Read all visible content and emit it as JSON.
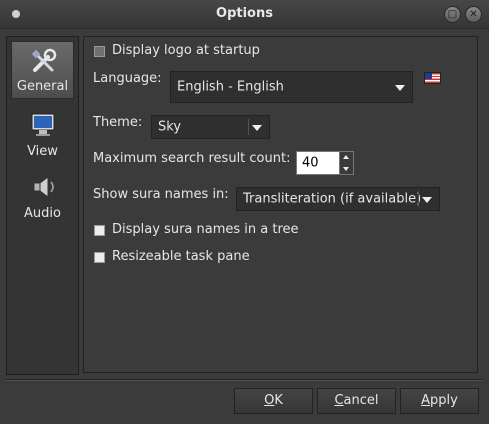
{
  "window": {
    "title": "Options"
  },
  "sidebar": {
    "items": [
      {
        "label": "General",
        "icon": "tools-icon",
        "active": true
      },
      {
        "label": "View",
        "icon": "monitor-icon",
        "active": false
      },
      {
        "label": "Audio",
        "icon": "speaker-icon",
        "active": false
      }
    ]
  },
  "general": {
    "display_logo": {
      "label": "Display logo at startup",
      "checked": false
    },
    "language": {
      "label": "Language:",
      "value": "English - English",
      "flag_icon": "us-flag-icon"
    },
    "theme": {
      "label": "Theme:",
      "value": "Sky"
    },
    "max_search": {
      "label": "Maximum search result count:",
      "value": "40"
    },
    "sura_names": {
      "label": "Show sura names in:",
      "value": "Transliteration (if available)"
    },
    "sura_tree": {
      "label": "Display sura names in a tree",
      "checked": false
    },
    "resizeable": {
      "label": "Resizeable task pane",
      "checked": false
    }
  },
  "buttons": {
    "ok": {
      "mnemonic": "O",
      "rest": "K"
    },
    "cancel": {
      "mnemonic": "C",
      "rest": "ancel"
    },
    "apply": {
      "mnemonic": "A",
      "rest": "pply"
    }
  }
}
